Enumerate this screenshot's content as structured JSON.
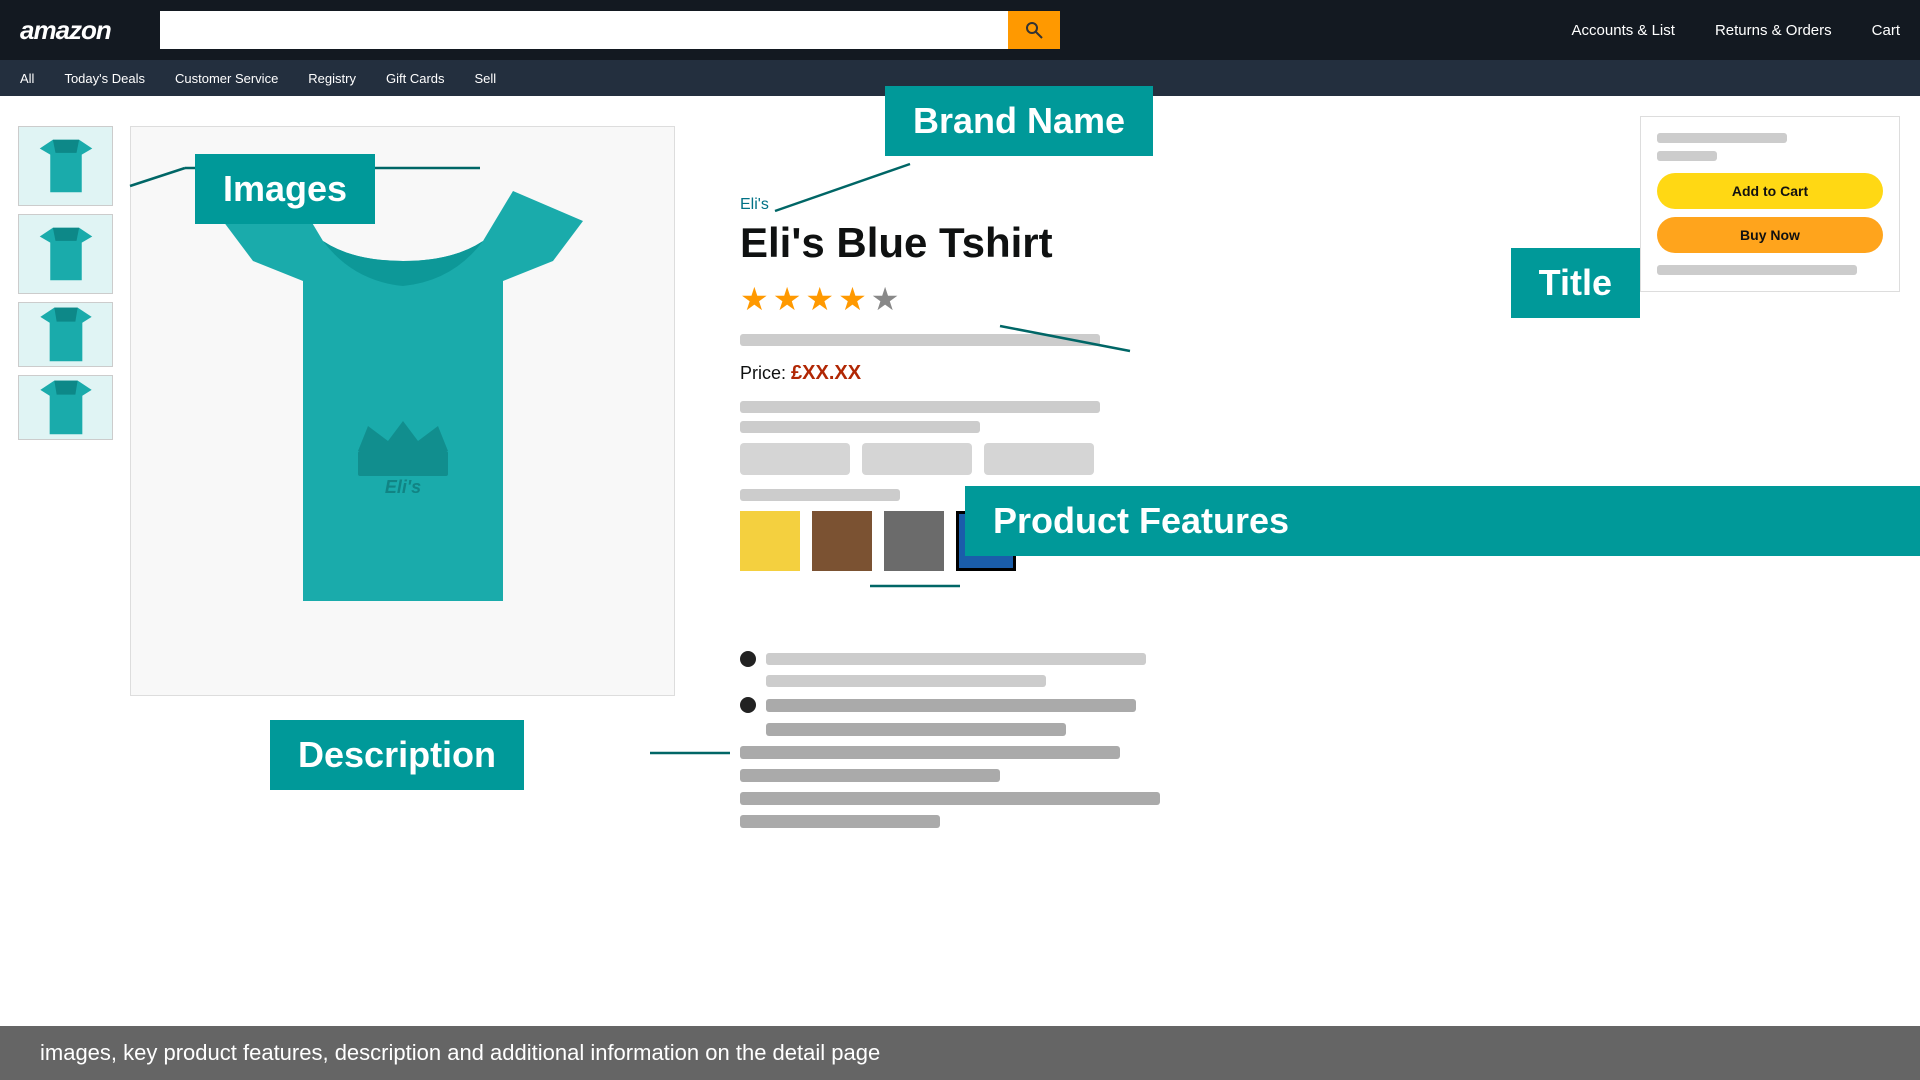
{
  "header": {
    "logo": "amazon",
    "search_placeholder": "",
    "search_btn_icon": "🔍",
    "nav_items": [
      "Accounts & List",
      "Returns & Orders",
      "Cart"
    ]
  },
  "subnav": {
    "items": [
      "All",
      "Today's Deals",
      "Customer Service",
      "Registry",
      "Gift Cards",
      "Sell"
    ]
  },
  "product": {
    "brand": "Eli's",
    "title": "Eli's Blue Tshirt",
    "stars": [
      true,
      true,
      true,
      true,
      false
    ],
    "price_label": "Price:",
    "price_value": "£XX.XX",
    "colors": [
      "#F4D03F",
      "#7B5232",
      "#6B6B6B",
      "#1A5DAA"
    ]
  },
  "annotations": {
    "images_label": "Images",
    "brand_name_label": "Brand Name",
    "title_label": "Title",
    "product_features_label": "Product Features",
    "description_label": "Description"
  },
  "cart_box": {
    "add_to_cart": "Add to Cart",
    "buy_now": "Buy Now"
  },
  "caption": "images, key product features, description and additional information on the detail page"
}
